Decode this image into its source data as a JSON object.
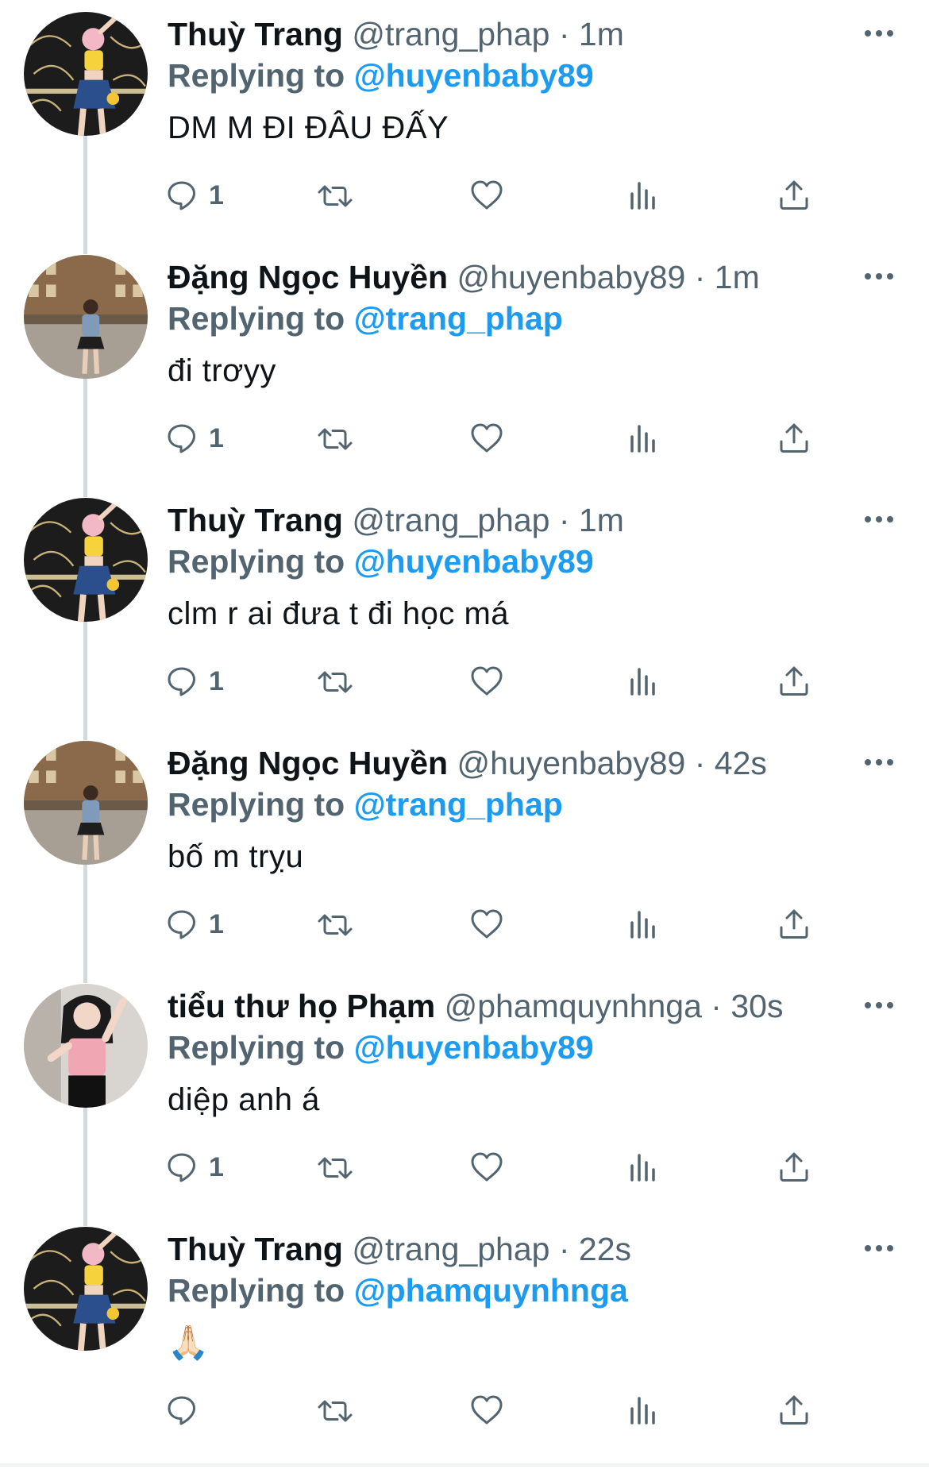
{
  "tweets": [
    {
      "display_name": "Thuỳ Trang",
      "handle_meta": "@trang_phap · 1m",
      "reply_prefix": "Replying to ",
      "reply_to": "@huyenbaby89",
      "text": "DM M ĐI ĐÂU ĐẤY",
      "reply_count": "1",
      "avatar": "avatar-pink-hair-yellow-top"
    },
    {
      "display_name": "Đặng Ngọc Huyền",
      "handle_meta": "@huyenbaby89 · 1m",
      "reply_prefix": "Replying to ",
      "reply_to": "@trang_phap",
      "text": "đi trơyy",
      "reply_count": "1",
      "avatar": "avatar-street-buildings"
    },
    {
      "display_name": "Thuỳ Trang",
      "handle_meta": "@trang_phap · 1m",
      "reply_prefix": "Replying to ",
      "reply_to": "@huyenbaby89",
      "text": "clm r ai đưa t đi học má",
      "reply_count": "1",
      "avatar": "avatar-pink-hair-yellow-top"
    },
    {
      "display_name": "Đặng Ngọc Huyền",
      "handle_meta": "@huyenbaby89 · 42s",
      "reply_prefix": "Replying to ",
      "reply_to": "@trang_phap",
      "text": "bố m trỵu",
      "reply_count": "1",
      "avatar": "avatar-street-buildings"
    },
    {
      "display_name": "tiểu thư họ Phạm",
      "handle_meta": "@phamquynhnga · 30s",
      "reply_prefix": "Replying to ",
      "reply_to": "@huyenbaby89",
      "text": "diệp anh á",
      "reply_count": "1",
      "avatar": "avatar-pink-tank-top"
    },
    {
      "display_name": "Thuỳ Trang",
      "handle_meta": "@trang_phap · 22s",
      "reply_prefix": "Replying to ",
      "reply_to": "@phamquynhnga",
      "text": "🙏🏻",
      "reply_count": "",
      "avatar": "avatar-pink-hair-yellow-top"
    }
  ],
  "icons": {
    "more": "more-icon",
    "reply": "reply-icon",
    "retweet": "retweet-icon",
    "like": "heart-icon",
    "views": "views-icon",
    "share": "share-icon"
  },
  "colors": {
    "link": "#1d9bf0",
    "secondary": "#536471",
    "primary_text": "#0f1419",
    "thread_line": "#cfd9de"
  }
}
